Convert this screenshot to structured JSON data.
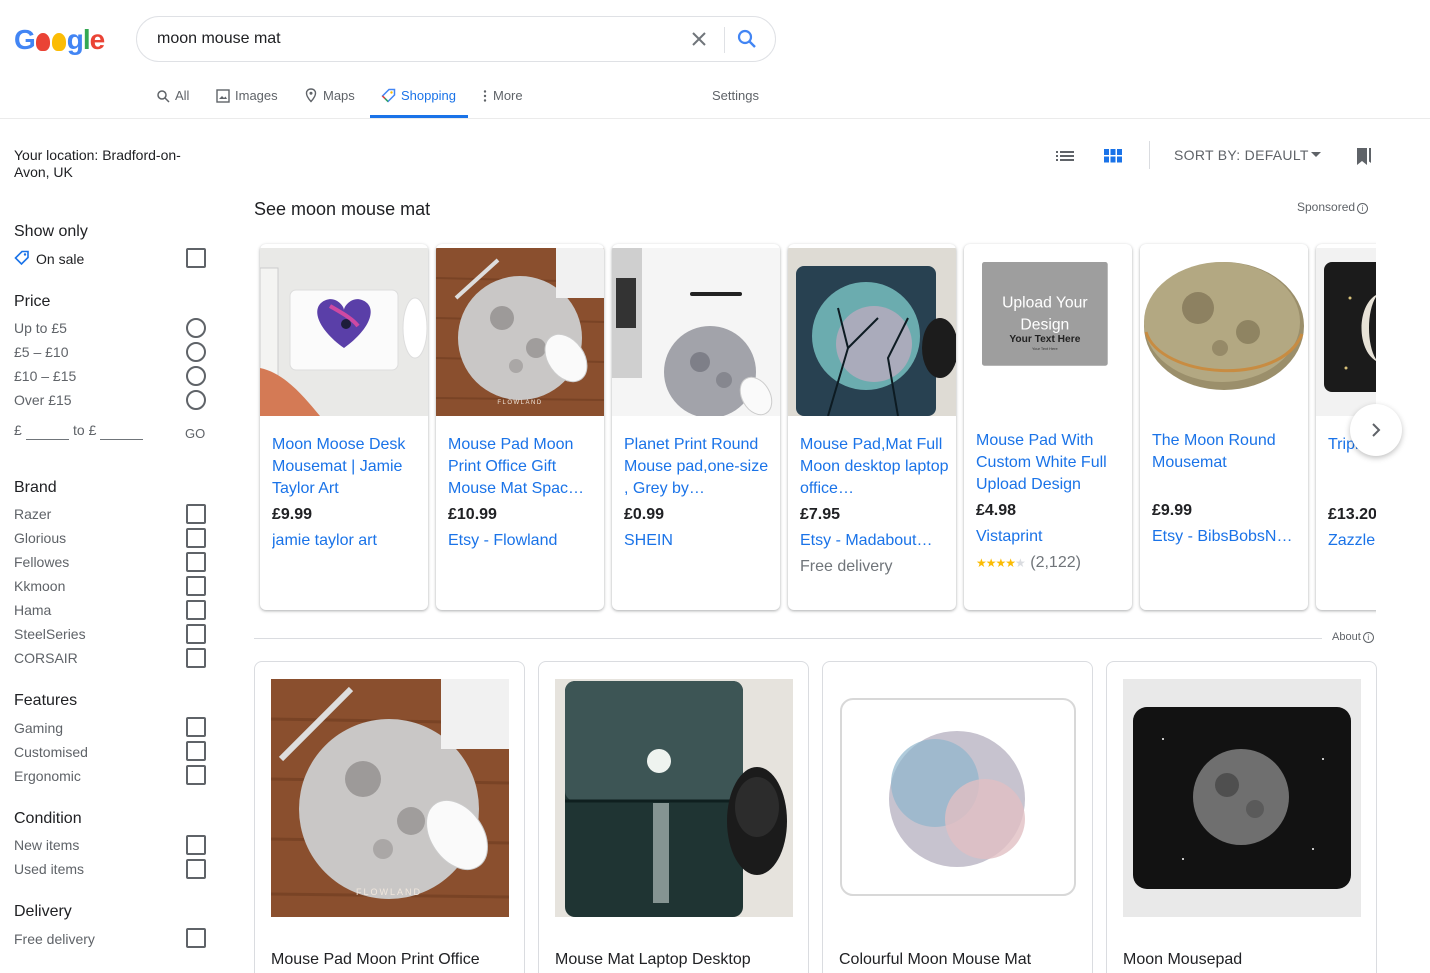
{
  "header": {
    "logo_text": "Google",
    "search_value": "moon mouse mat",
    "icons": {
      "clear": "close-icon",
      "search": "search-icon"
    }
  },
  "tabs": [
    {
      "label": "All",
      "icon": "search-icon",
      "active": false
    },
    {
      "label": "Images",
      "icon": "image-icon",
      "active": false
    },
    {
      "label": "Maps",
      "icon": "map-pin-icon",
      "active": false
    },
    {
      "label": "Shopping",
      "icon": "tag-icon",
      "active": true
    },
    {
      "label": "More",
      "icon": "more-vert-icon",
      "active": false
    }
  ],
  "settings_label": "Settings",
  "sidebar": {
    "location": "Your location: Bradford-on-Avon, UK",
    "show_only": {
      "heading": "Show only",
      "on_sale": "On sale"
    },
    "price": {
      "heading": "Price",
      "options": [
        "Up to £5",
        "£5 – £10",
        "£10 – £15",
        "Over £15"
      ],
      "min_prefix": "£",
      "to_label": "to £",
      "go_label": "GO"
    },
    "brand": {
      "heading": "Brand",
      "options": [
        "Razer",
        "Glorious",
        "Fellowes",
        "Kkmoon",
        "Hama",
        "SteelSeries",
        "CORSAIR"
      ]
    },
    "features": {
      "heading": "Features",
      "options": [
        "Gaming",
        "Customised",
        "Ergonomic"
      ]
    },
    "condition": {
      "heading": "Condition",
      "options": [
        "New items",
        "Used items"
      ]
    },
    "delivery": {
      "heading": "Delivery",
      "options": [
        "Free delivery"
      ]
    }
  },
  "toolbar": {
    "sort_label": "SORT BY: DEFAULT",
    "view_list_icon": "list-view-icon",
    "view_grid_icon": "grid-view-icon",
    "bookmark_icon": "bookmark-icon",
    "accent": "#1a73e8"
  },
  "sponsored_section": {
    "title": "See moon mouse mat",
    "sponsored_label": "Sponsored",
    "products": [
      {
        "title": "Moon Moose Desk Mousemat | Jamie Taylor Art",
        "price": "£9.99",
        "seller": "jamie taylor art",
        "extra": ""
      },
      {
        "title": "Mouse Pad Moon Print Office Gift Mouse Mat Spac…",
        "price": "£10.99",
        "seller": "Etsy - Flowland",
        "extra": ""
      },
      {
        "title": "Planet Print Round Mouse pad,one-size , Grey by…",
        "price": "£0.99",
        "seller": "SHEIN",
        "extra": ""
      },
      {
        "title": "Mouse Pad,Mat Full Moon desktop laptop office…",
        "price": "£7.95",
        "seller": "Etsy - Madabout…",
        "extra": "Free delivery"
      },
      {
        "title": "Mouse Pad With Custom White Full Upload Design",
        "price": "£4.98",
        "seller": "Vistaprint",
        "extra": "(2,122)",
        "rating": 4
      },
      {
        "title": "The Moon Round Mousemat",
        "price": "£9.99",
        "seller": "Etsy - BibsBobsN…",
        "extra": ""
      },
      {
        "title": "Triple Moons Mat",
        "price": "£13.20",
        "seller": "Zazzle",
        "extra": ""
      }
    ],
    "upload_image_text": {
      "line1": "Upload Your",
      "line2": "Design",
      "line3": "Your Text Here",
      "line4": "Your Text Here"
    },
    "flowland_watermark": "FLOWLAND"
  },
  "about_label": "About",
  "results": [
    {
      "title": "Mouse Pad Moon Print Office"
    },
    {
      "title": "Mouse Mat Laptop Desktop"
    },
    {
      "title": "Colourful Moon Mouse Mat"
    },
    {
      "title": "Moon Mousepad"
    }
  ]
}
